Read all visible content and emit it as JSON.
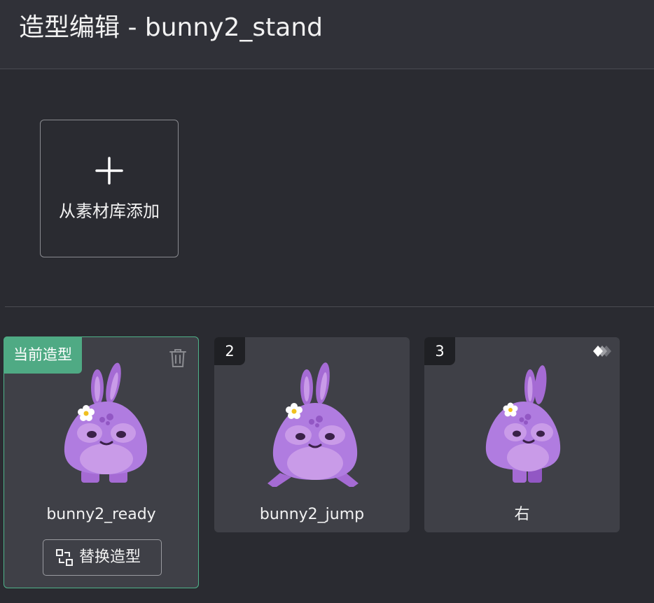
{
  "header": {
    "title": "造型编辑 - bunny2_stand"
  },
  "add_tile": {
    "label": "从素材库添加"
  },
  "costumes": [
    {
      "name": "bunny2_ready",
      "badge": "当前造型",
      "action_label": "替换造型"
    },
    {
      "name": "bunny2_jump",
      "badge": "2"
    },
    {
      "name": "右",
      "badge": "3"
    }
  ],
  "colors": {
    "accent": "#4faa84",
    "background": "#2a2b31",
    "card": "#3f4047",
    "bunny": "#b07ce0"
  }
}
